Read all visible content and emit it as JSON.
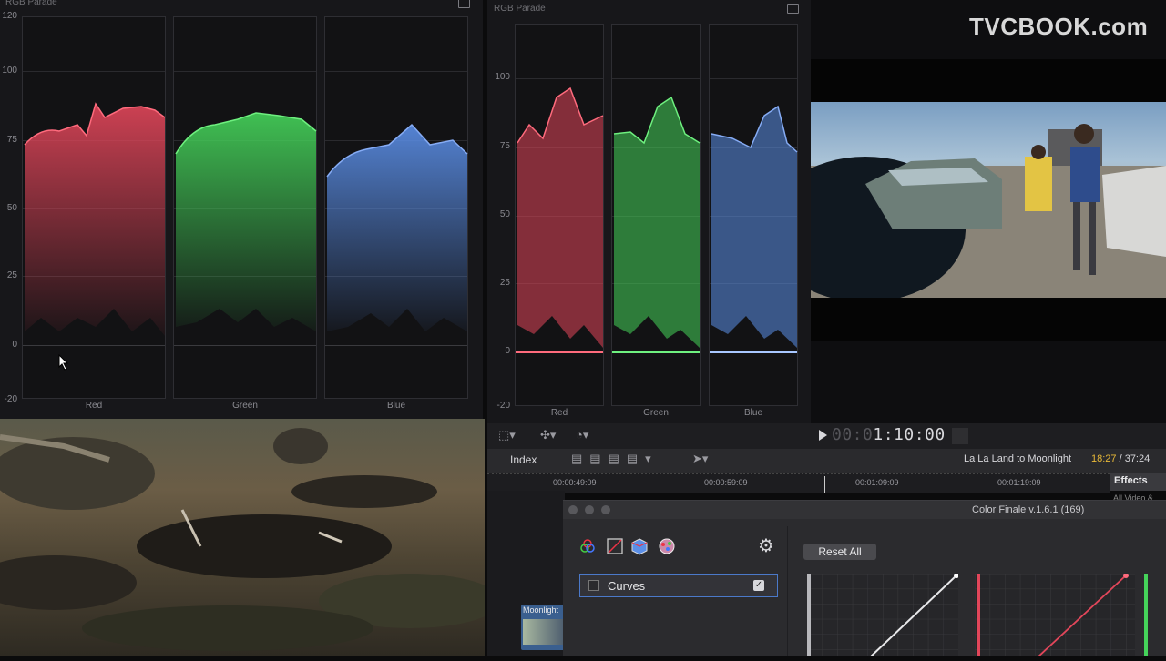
{
  "watermark": "TVCBOOK.com",
  "scope_left": {
    "title": "RGB Parade",
    "y_ticks": [
      "120",
      "100",
      "75",
      "50",
      "25",
      "0",
      "-20"
    ],
    "columns": [
      {
        "label": "Red",
        "color": "#e2465a"
      },
      {
        "label": "Green",
        "color": "#45d35a"
      },
      {
        "label": "Blue",
        "color": "#5b8fe8"
      }
    ]
  },
  "scope_right": {
    "title": "RGB Parade",
    "y_ticks": [
      "100",
      "75",
      "50",
      "25",
      "0",
      "-20"
    ],
    "columns": [
      {
        "label": "Red",
        "color": "#e2465a"
      },
      {
        "label": "Green",
        "color": "#45d35a"
      },
      {
        "label": "Blue",
        "color": "#5b8fe8"
      }
    ]
  },
  "transport": {
    "timecode_dim": "00:0",
    "timecode": "1:10:00"
  },
  "index_bar": {
    "index_label": "Index",
    "project_name": "La La Land to Moonlight",
    "time_current": "18:27",
    "time_total": " / 37:24"
  },
  "ruler": {
    "ticks": [
      "00:00:49:09",
      "00:00:59:09",
      "00:01:09:09",
      "00:01:19:09"
    ]
  },
  "effects_label": "Effects",
  "effects_sub": "All Video & ...",
  "clip_label": "Moonlight",
  "plugin": {
    "title": "Color Finale v.1.6.1 (169)",
    "reset_label": "Reset All",
    "layer_name": "Curves"
  }
}
